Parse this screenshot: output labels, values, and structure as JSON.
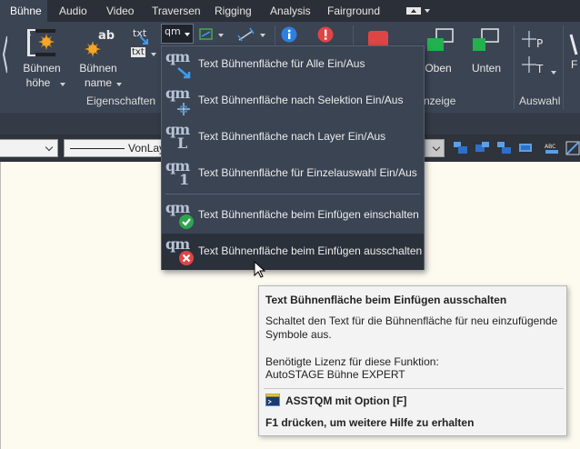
{
  "tabs": [
    {
      "label": "Bühne",
      "active": true
    },
    {
      "label": "Audio",
      "active": false
    },
    {
      "label": "Video",
      "active": false
    },
    {
      "label": "Traversen",
      "active": false
    },
    {
      "label": "Rigging",
      "active": false
    },
    {
      "label": "Analysis",
      "active": false
    },
    {
      "label": "Fairground",
      "active": false
    }
  ],
  "ribbon": {
    "buehnen_hoehe": {
      "line1": "Bühnen",
      "line2": "höhe"
    },
    "buehnen_name": {
      "line1": "Bühnen",
      "line2": "name"
    },
    "oben": "Oben",
    "unten": "Unten",
    "groups": {
      "eigenschaften": "Eigenschaften",
      "anzeige_partial": "nzeige",
      "auswahl": "Auswahl"
    },
    "mini_labels": {
      "txt": "txt",
      "ab": "ab",
      "qm": "qm"
    }
  },
  "propbar": {
    "linetype": "VonLay"
  },
  "menu": {
    "items": [
      {
        "label": "Text Bühnenfläche für Alle Ein/Aus",
        "icon": "qm-arrow-icon",
        "hover": false
      },
      {
        "label": "Text Bühnenfläche nach Selektion Ein/Aus",
        "icon": "qm-cursor-icon",
        "hover": false
      },
      {
        "label": "Text Bühnenfläche nach Layer Ein/Aus",
        "icon": "qm-layer-icon",
        "hover": false
      },
      {
        "label": "Text Bühnenfläche für Einzelauswahl Ein/Aus",
        "icon": "qm-single-icon",
        "hover": false
      },
      {
        "label": "Text Bühnenfläche beim Einfügen einschalten",
        "icon": "qm-check-icon",
        "hover": false
      },
      {
        "label": "Text Bühnenfläche beim Einfügen ausschalten",
        "icon": "qm-cross-icon",
        "hover": true
      }
    ],
    "qm": "qm",
    "suffix": {
      "layer": "L",
      "single": "1"
    }
  },
  "tooltip": {
    "title": "Text Bühnenfläche beim Einfügen ausschalten",
    "description": "Schaltet den Text für die Bühnenfläche für neu einzufügende Symbole aus.",
    "license_label": "Benötigte Lizenz für diese Funktion:",
    "license_value": "AutoSTAGE Bühne EXPERT",
    "command": "ASSTQM mit Option [F]",
    "help": "F1 drücken, um weitere Hilfe zu erhalten"
  },
  "colors": {
    "ribbon_bg": "#3b4453",
    "tabbar_bg": "#2b3038",
    "canvas_bg": "#fdfaf0",
    "check_green": "#2ea44f",
    "cross_red": "#e04545",
    "info_blue": "#2f7fe0"
  }
}
